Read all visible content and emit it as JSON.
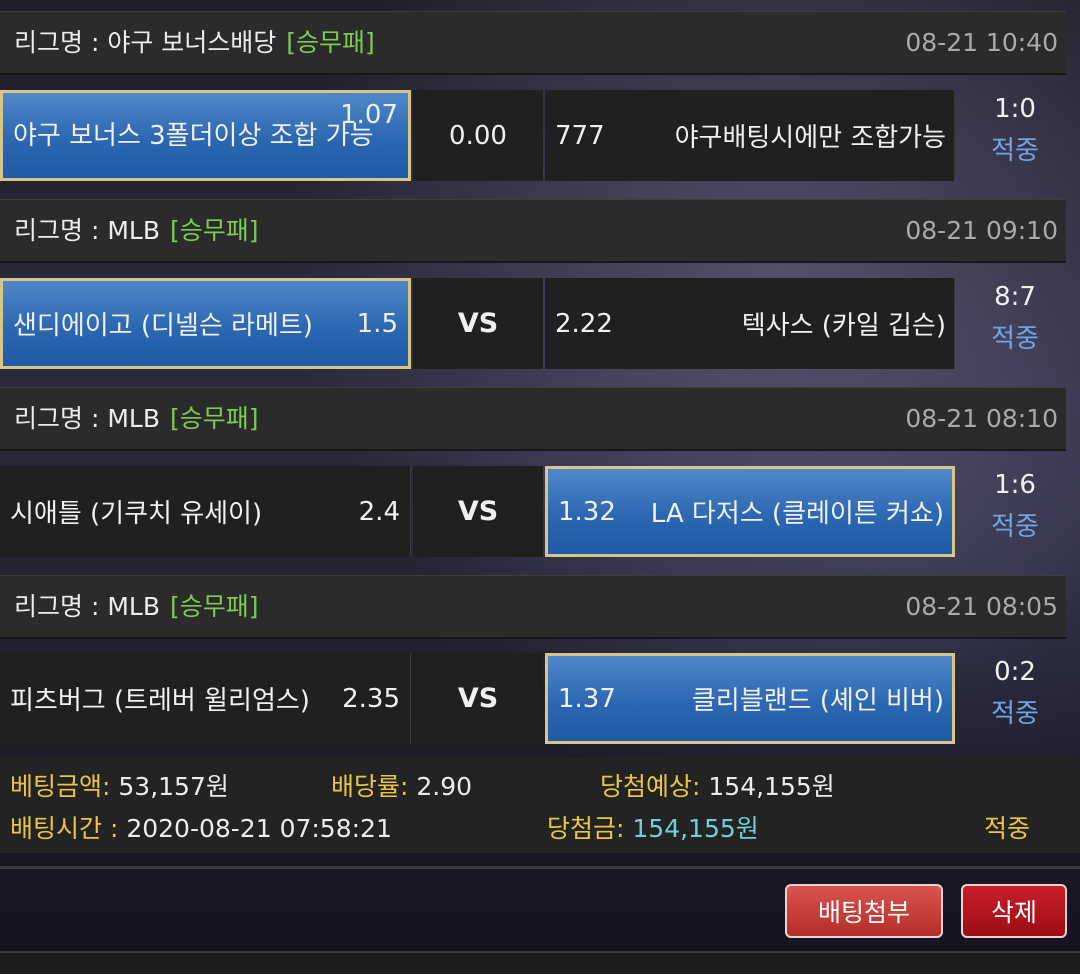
{
  "games": [
    {
      "league_label": "리그명 : 야구 보너스배당",
      "tag": "[승무패]",
      "time": "08-21 10:40",
      "home": {
        "name": "야구 보너스 3폴더이상 조합 가능",
        "odd": "1.07",
        "selected": true
      },
      "mid": "0.00",
      "away": {
        "odd": "777",
        "name": "야구배팅시에만 조합가능",
        "selected": false
      },
      "score": "1:0",
      "status": "적중"
    },
    {
      "league_label": "리그명 : MLB",
      "tag": "[승무패]",
      "time": "08-21 09:10",
      "home": {
        "name": "샌디에이고 (디넬슨 라메트)",
        "odd": "1.5",
        "selected": true
      },
      "mid": "VS",
      "away": {
        "odd": "2.22",
        "name": "텍사스 (카일 깁슨)",
        "selected": false
      },
      "score": "8:7",
      "status": "적중"
    },
    {
      "league_label": "리그명 : MLB",
      "tag": "[승무패]",
      "time": "08-21 08:10",
      "home": {
        "name": "시애틀 (기쿠치 유세이)",
        "odd": "2.4",
        "selected": false
      },
      "mid": "VS",
      "away": {
        "odd": "1.32",
        "name": "LA 다저스 (클레이튼 커쇼)",
        "selected": true
      },
      "score": "1:6",
      "status": "적중"
    },
    {
      "league_label": "리그명 : MLB",
      "tag": "[승무패]",
      "time": "08-21 08:05",
      "home": {
        "name": "피츠버그 (트레버 윌리엄스)",
        "odd": "2.35",
        "selected": false
      },
      "mid": "VS",
      "away": {
        "odd": "1.37",
        "name": "클리블랜드 (셰인 비버)",
        "selected": true
      },
      "score": "0:2",
      "status": "적중"
    }
  ],
  "summary": {
    "bet_amount_label": "베팅금액:",
    "bet_amount": "53,157원",
    "odds_label": "배당률:",
    "odds": "2.90",
    "expected_label": "당첨예상:",
    "expected": "154,155원",
    "bet_time_label": "배팅시간 :",
    "bet_time": "2020-08-21 07:58:21",
    "win_label": "당첨금:",
    "win_amount": "154,155원",
    "result": "적중"
  },
  "buttons": {
    "attach": "배팅첨부",
    "delete": "삭제"
  },
  "colors": {
    "selected_bg": "#2c67b1",
    "selected_border": "#d9c58a",
    "tag": "#7ecb53",
    "status_blue": "#6fa5e6",
    "label_yellow": "#e9c543",
    "win_cyan": "#6fd0d6",
    "delete_red": "#b0121a"
  }
}
